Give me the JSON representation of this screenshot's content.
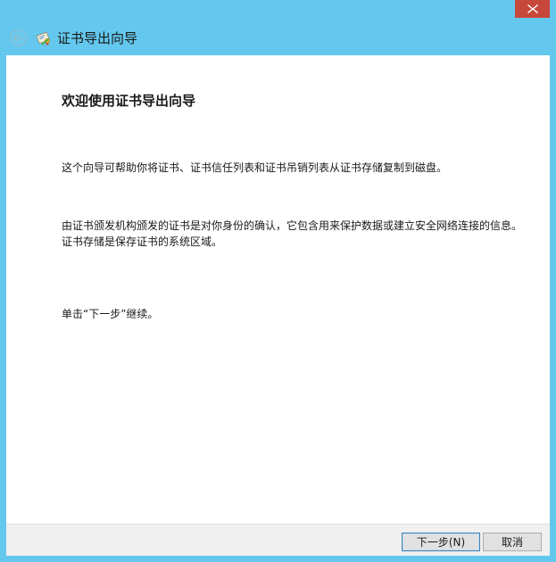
{
  "window": {
    "title": "证书导出向导"
  },
  "icons": {
    "close": "close-icon",
    "back": "back-arrow-icon",
    "certificate": "certificate-icon"
  },
  "content": {
    "heading": "欢迎使用证书导出向导",
    "paragraph1": "这个向导可帮助你将证书、证书信任列表和证书吊销列表从证书存储复制到磁盘。",
    "paragraph2": "由证书颁发机构颁发的证书是对你身份的确认，它包含用来保护数据或建立安全网络连接的信息。证书存储是保存证书的系统区域。",
    "paragraph3": "单击“下一步”继续。"
  },
  "footer": {
    "next_label": "下一步(N)",
    "cancel_label": "取消"
  },
  "colors": {
    "titlebar": "#64c8ee",
    "close": "#c7473a",
    "panel": "#ffffff",
    "footer": "#f0f0f0"
  }
}
